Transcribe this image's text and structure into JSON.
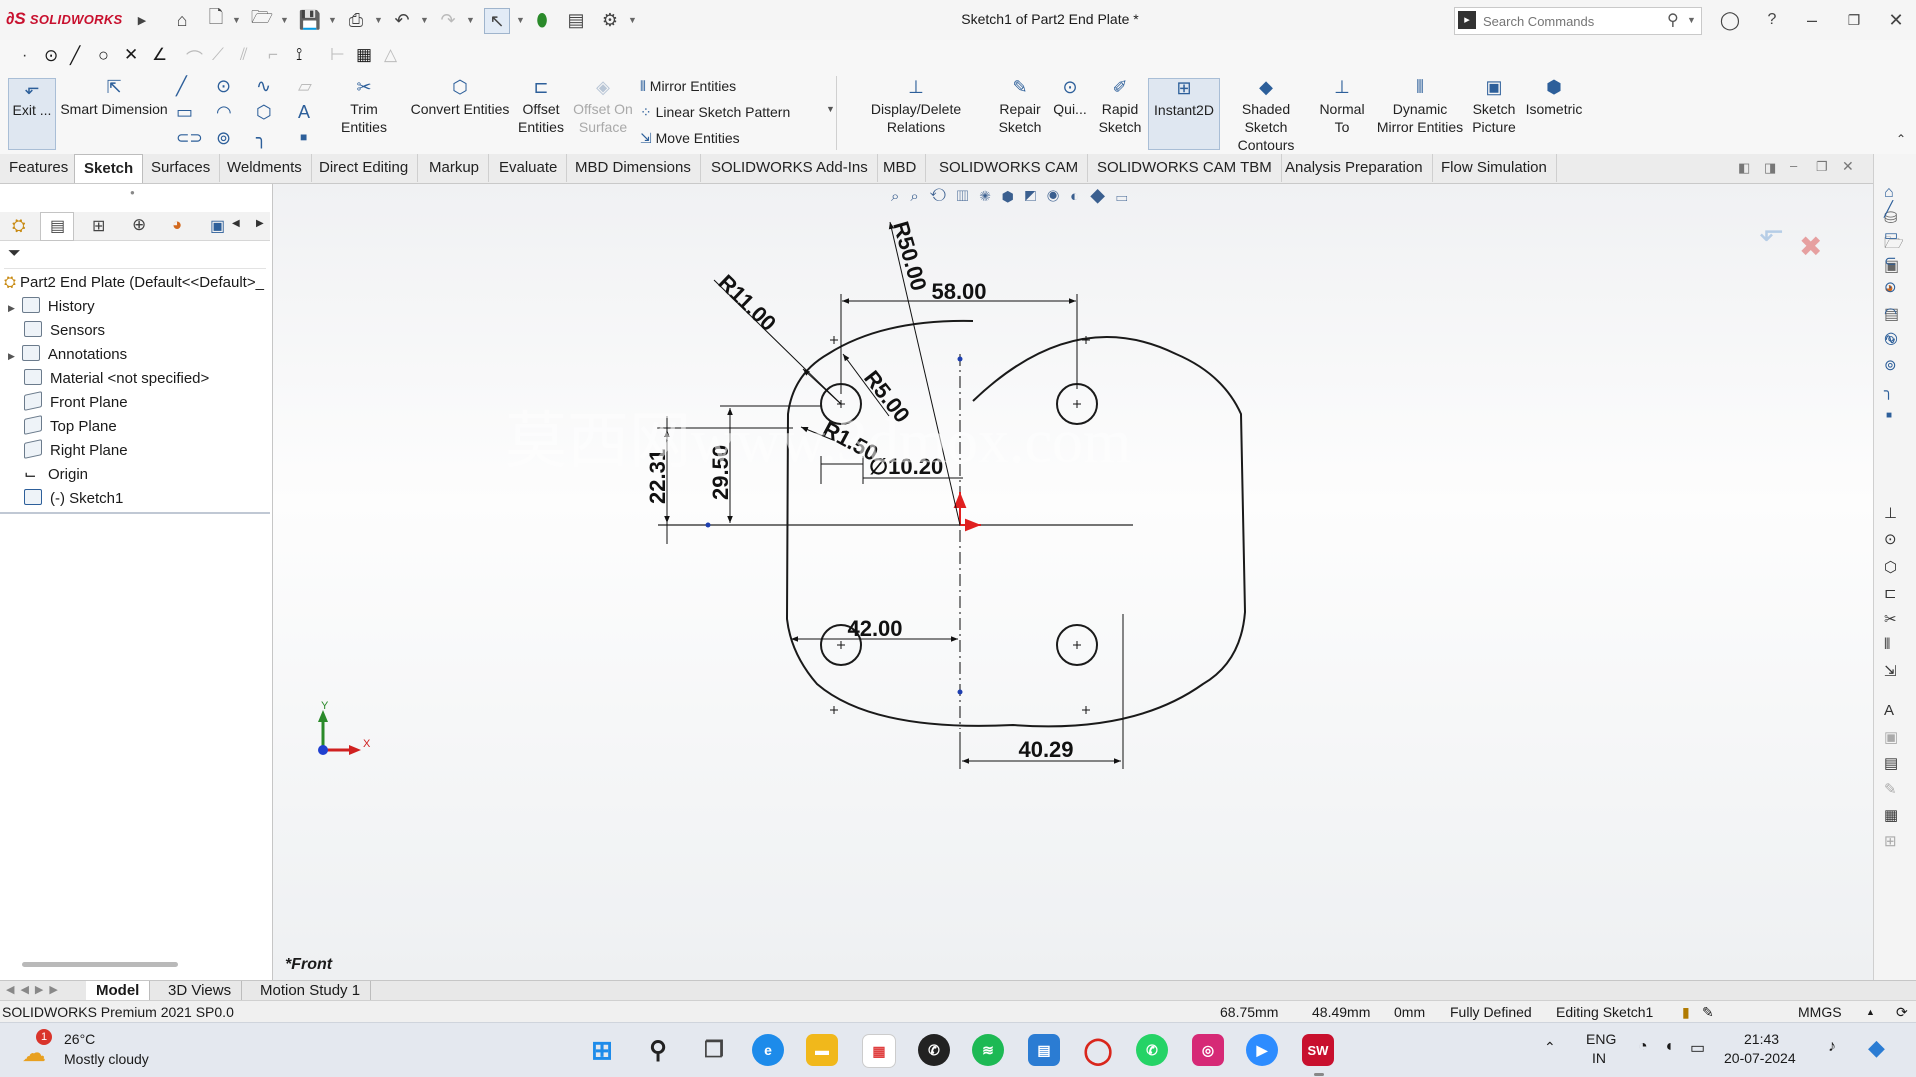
{
  "app": {
    "brand": "SOLIDWORKS",
    "title": "Sketch1 of Part2 End Plate *"
  },
  "search": {
    "placeholder": "Search Commands"
  },
  "ribbon": {
    "exit": "Exit ...",
    "smart_dimension": "Smart Dimension",
    "trim": "Trim Entities",
    "convert": "Convert Entities",
    "offset": "Offset Entities",
    "offset_surface": "Offset On Surface",
    "mirror": "Mirror Entities",
    "linear_pattern": "Linear Sketch Pattern",
    "move": "Move Entities",
    "display_relations": "Display/Delete Relations",
    "repair": "Repair Sketch",
    "quick": "Qui...",
    "rapid": "Rapid Sketch",
    "instant2d": "Instant2D",
    "shaded": "Shaded Sketch Contours",
    "normal_to": "Normal To",
    "dynamic_mirror": "Dynamic Mirror Entities",
    "sketch_picture": "Sketch Picture",
    "isometric": "Isometric"
  },
  "tabs": [
    "Features",
    "Sketch",
    "Surfaces",
    "Weldments",
    "Direct Editing",
    "Markup",
    "Evaluate",
    "MBD Dimensions",
    "SOLIDWORKS Add-Ins",
    "MBD",
    "SOLIDWORKS CAM",
    "SOLIDWORKS CAM TBM",
    "Analysis Preparation",
    "Flow Simulation"
  ],
  "tree": {
    "root": "Part2 End Plate  (Default<<Default>_",
    "items": [
      "History",
      "Sensors",
      "Annotations",
      "Material <not specified>",
      "Front Plane",
      "Top Plane",
      "Right Plane",
      "Origin",
      "(-) Sketch1"
    ]
  },
  "viewport": {
    "view_label": "*Front",
    "watermark": "莫西网www.3dmox.com",
    "axis_x": "X",
    "axis_y": "Y",
    "dims": {
      "r50": "R50.00",
      "r11": "R11.00",
      "r5": "R5.00",
      "r150": "R1.50",
      "w58": "58.00",
      "d1020": "∅10.20",
      "h2950": "29.50",
      "h2231": "22.31",
      "w42": "42.00",
      "w4029": "40.29"
    }
  },
  "bottom_tabs": [
    "Model",
    "3D Views",
    "Motion Study 1"
  ],
  "status": {
    "product": "SOLIDWORKS Premium 2021 SP0.0",
    "x": "68.75mm",
    "y": "48.49mm",
    "z": "0mm",
    "state": "Fully Defined",
    "mode": "Editing Sketch1",
    "units": "MMGS"
  },
  "taskbar": {
    "temp": "26°C",
    "weather": "Mostly cloudy",
    "weather_badge": "1",
    "lang1": "ENG",
    "lang2": "IN",
    "time": "21:43",
    "date": "20-07-2024",
    "sw_badge": "SW"
  },
  "colors": {
    "accent": "#2d5f9a",
    "brand_red": "#c8102e",
    "origin_red": "#e02020",
    "select_blue": "#1e3fb0"
  }
}
